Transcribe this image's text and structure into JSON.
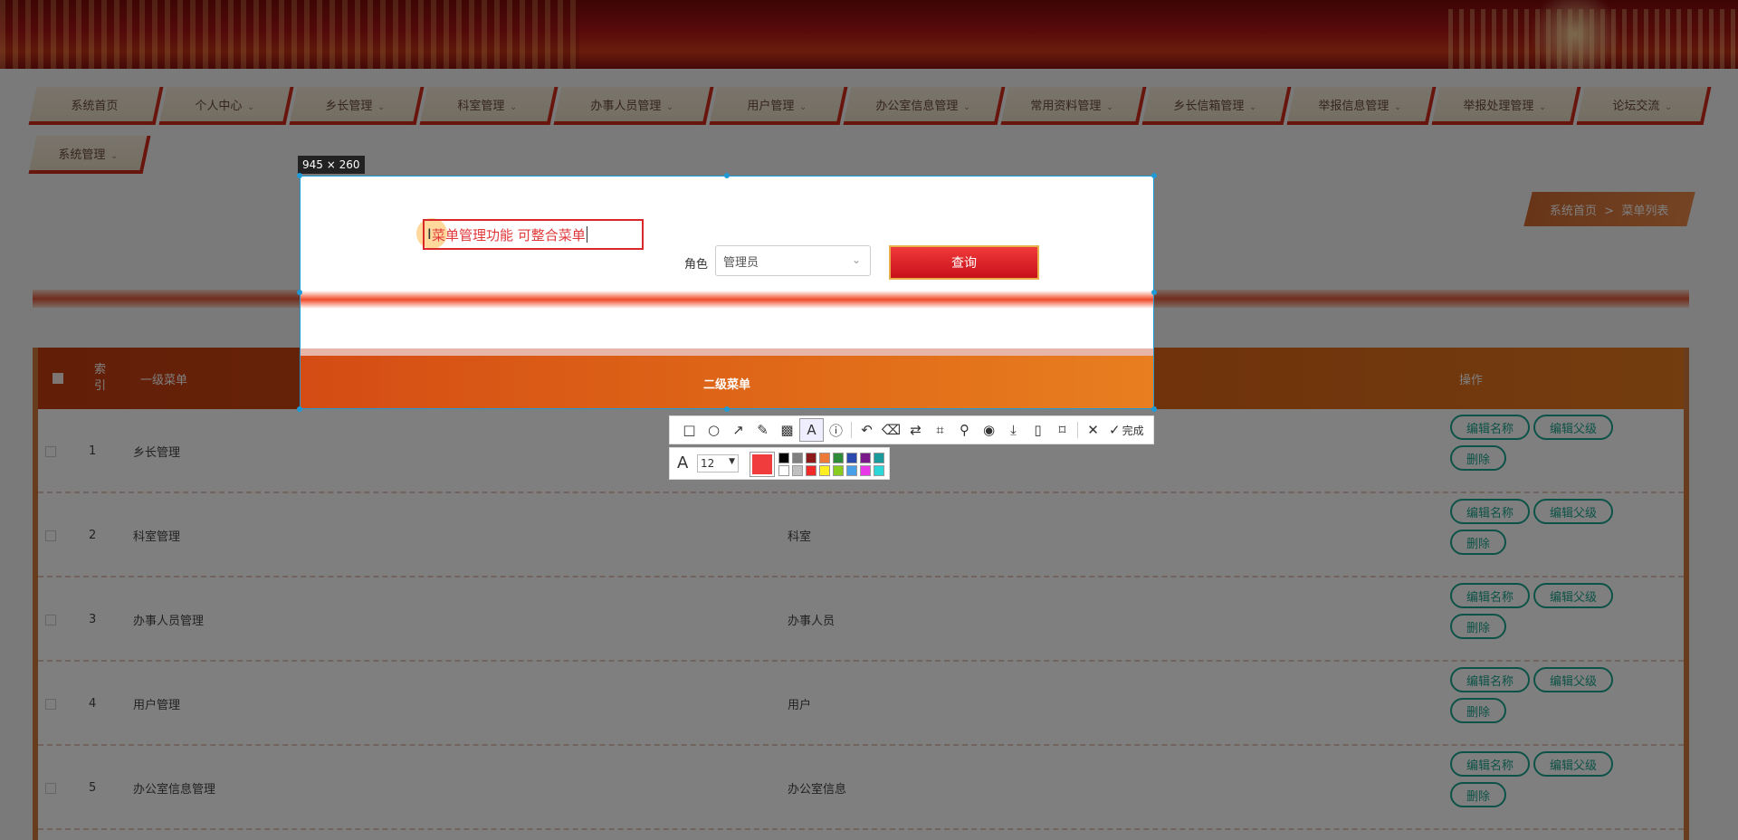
{
  "nav": {
    "items": [
      {
        "label": "系统首页",
        "chevron": false
      },
      {
        "label": "个人中心",
        "chevron": true
      },
      {
        "label": "乡长管理",
        "chevron": true
      },
      {
        "label": "科室管理",
        "chevron": true
      },
      {
        "label": "办事人员管理",
        "chevron": true
      },
      {
        "label": "用户管理",
        "chevron": true
      },
      {
        "label": "办公室信息管理",
        "chevron": true
      },
      {
        "label": "常用资料管理",
        "chevron": true
      },
      {
        "label": "乡长信箱管理",
        "chevron": true
      },
      {
        "label": "举报信息管理",
        "chevron": true
      },
      {
        "label": "举报处理管理",
        "chevron": true
      },
      {
        "label": "论坛交流",
        "chevron": true
      },
      {
        "label": "系统管理",
        "chevron": true
      }
    ],
    "chevron_glyph": "⌄"
  },
  "breadcrumb": {
    "home": "系统首页",
    "separator": ">",
    "current": "菜单列表"
  },
  "search": {
    "role_label": "角色",
    "role_value": "管理员",
    "query_label": "查询"
  },
  "table": {
    "headers": {
      "index": "索引",
      "first_menu": "一级菜单",
      "second_menu": "二级菜单",
      "actions": "操作"
    },
    "rows": [
      {
        "index": "1",
        "first": "乡长管理",
        "second": ""
      },
      {
        "index": "2",
        "first": "科室管理",
        "second": "科室"
      },
      {
        "index": "3",
        "first": "办事人员管理",
        "second": "办事人员"
      },
      {
        "index": "4",
        "first": "用户管理",
        "second": "用户"
      },
      {
        "index": "5",
        "first": "办公室信息管理",
        "second": "办公室信息"
      }
    ],
    "actions": {
      "edit_name": "编辑名称",
      "edit_parent": "编辑父级",
      "delete": "删除"
    }
  },
  "screenshot": {
    "dimensions": "945 × 260",
    "annotation_text": "菜单管理功能 可整合菜单",
    "visible_header": "二级菜单"
  },
  "toolbar": {
    "tools": [
      {
        "name": "rectangle-tool-icon",
        "glyph": "□"
      },
      {
        "name": "ellipse-tool-icon",
        "glyph": "○"
      },
      {
        "name": "arrow-tool-icon",
        "glyph": "↗"
      },
      {
        "name": "pen-tool-icon",
        "glyph": "✎"
      },
      {
        "name": "mosaic-tool-icon",
        "glyph": "▩"
      },
      {
        "name": "text-tool-icon",
        "glyph": "A",
        "active": true
      },
      {
        "name": "number-marker-icon",
        "glyph": "ⓘ"
      },
      {
        "name": "undo-icon",
        "glyph": "↶"
      },
      {
        "name": "erase-icon",
        "glyph": "⌫"
      },
      {
        "name": "translate-icon",
        "glyph": "⇄"
      },
      {
        "name": "scan-icon",
        "glyph": "⌗"
      },
      {
        "name": "pin-icon",
        "glyph": "⚲"
      },
      {
        "name": "record-icon",
        "glyph": "◉"
      },
      {
        "name": "download-icon",
        "glyph": "⤓"
      },
      {
        "name": "phone-icon",
        "glyph": "▯"
      },
      {
        "name": "bookmark-icon",
        "glyph": "⌑"
      },
      {
        "name": "close-icon",
        "glyph": "✕"
      }
    ],
    "done_label": "完成",
    "done_glyph": "✓"
  },
  "text_props": {
    "font_glyph": "A",
    "font_size": "12",
    "current_color": "#f03c3c",
    "palette": [
      "#000000",
      "#808080",
      "#8b1a1a",
      "#ee7a3a",
      "#2e8b3a",
      "#2a4ab0",
      "#7a1a8a",
      "#1a9a9a",
      "#ffffff",
      "#c0c0c0",
      "#ee2a2a",
      "#ffee22",
      "#88cc22",
      "#4aa0e8",
      "#e83ae8",
      "#2ad8d8"
    ]
  },
  "colors": {
    "accent": "#d02a1a",
    "action": "#1aa58e",
    "selection": "#1e9bd7"
  }
}
